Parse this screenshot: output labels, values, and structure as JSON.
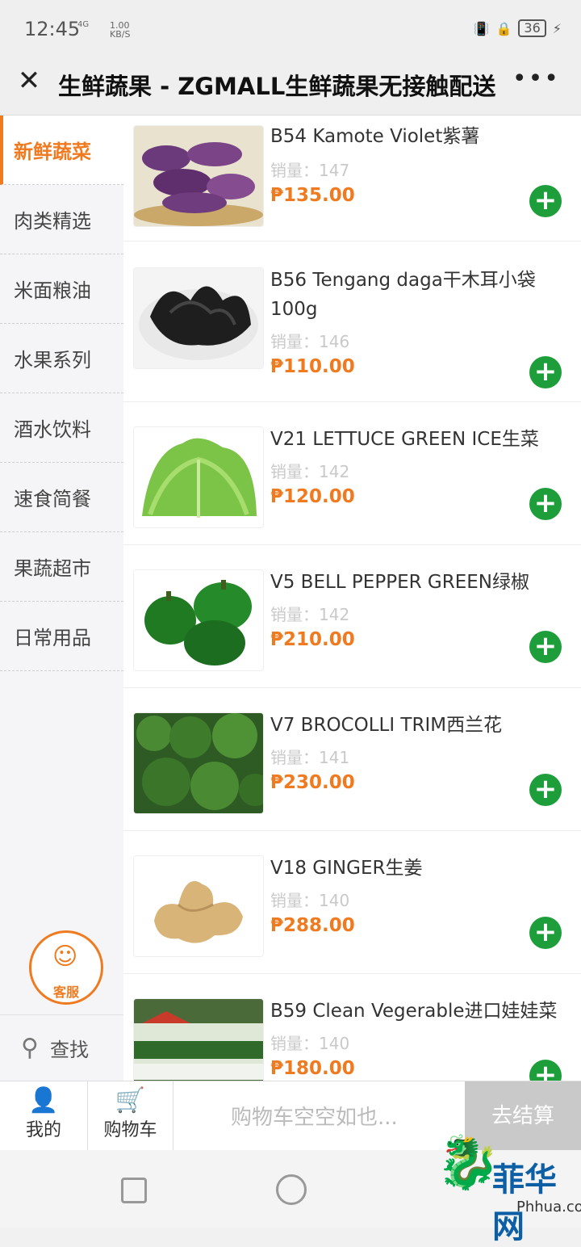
{
  "status": {
    "time": "12:45",
    "network": "4G",
    "speed_value": "1.00",
    "speed_unit": "KB/S",
    "battery": "36"
  },
  "header": {
    "close_icon": "close-icon",
    "title": "生鲜蔬果 - ZGMALL生鲜蔬果无接触配送",
    "more_icon": "more-icon"
  },
  "sidebar": {
    "categories": [
      "新鲜蔬菜",
      "肉类精选",
      "米面粮油",
      "水果系列",
      "酒水饮料",
      "速食简餐",
      "果蔬超市",
      "日常用品"
    ],
    "active_index": 0,
    "service_label": "客服",
    "search_label": "查找"
  },
  "products": [
    {
      "name": "B54 Kamote Violet紫薯",
      "sales": "销量：147",
      "price": "₱135.00",
      "image": "purple-sweet-potato"
    },
    {
      "name": "B56 Tengang daga干木耳小袋100g",
      "sales": "销量：146",
      "price": "₱110.00",
      "image": "dried-wood-ear"
    },
    {
      "name": "V21 LETTUCE GREEN ICE生菜",
      "sales": "销量：142",
      "price": "₱120.00",
      "image": "lettuce"
    },
    {
      "name": "V5 BELL PEPPER GREEN绿椒",
      "sales": "销量：142",
      "price": "₱210.00",
      "image": "green-bell-pepper"
    },
    {
      "name": "V7 BROCOLLI TRIM西兰花",
      "sales": "销量：141",
      "price": "₱230.00",
      "image": "broccoli"
    },
    {
      "name": "V18 GINGER生姜",
      "sales": "销量：140",
      "price": "₱288.00",
      "image": "ginger"
    },
    {
      "name": "B59 Clean Vegerable进口娃娃菜",
      "sales": "销量：140",
      "price": "₱180.00",
      "image": "baby-cabbage"
    }
  ],
  "bottombar": {
    "mine_label": "我的",
    "cart_label": "购物车",
    "cart_empty": "购物车空空如也...",
    "checkout_label": "去结算"
  },
  "watermark": {
    "brand": "菲华网",
    "site": "Phhua.com"
  },
  "colors": {
    "accent": "#f07a1f",
    "add_button": "#1e9e3a"
  }
}
